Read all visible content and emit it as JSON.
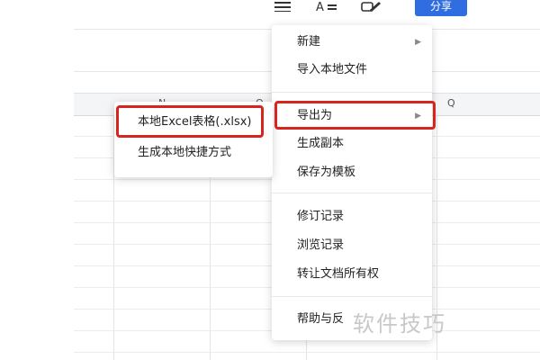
{
  "toolbar": {
    "icons": [
      "menu-icon",
      "text-format-icon",
      "pen-icon"
    ],
    "share_label": "分享"
  },
  "sheet": {
    "columns": [
      "N",
      "O",
      "Q"
    ]
  },
  "menu": {
    "items": [
      {
        "label": "新建",
        "has_submenu": true
      },
      {
        "label": "导入本地文件",
        "has_submenu": false
      },
      {
        "label": "导出为",
        "has_submenu": true,
        "highlighted": true
      },
      {
        "label": "生成副本",
        "has_submenu": false
      },
      {
        "label": "保存为模板",
        "has_submenu": false
      },
      {
        "label": "修订记录",
        "has_submenu": false
      },
      {
        "label": "浏览记录",
        "has_submenu": false
      },
      {
        "label": "转让文档所有权",
        "has_submenu": false
      },
      {
        "label": "帮助与反",
        "has_submenu": false
      }
    ]
  },
  "submenu": {
    "items": [
      {
        "label": "本地Excel表格(.xlsx)",
        "highlighted": true
      },
      {
        "label": "生成本地快捷方式"
      }
    ]
  },
  "watermark": "软件技巧",
  "colors": {
    "highlight": "#d7241c",
    "share_button": "#2f6de1"
  }
}
